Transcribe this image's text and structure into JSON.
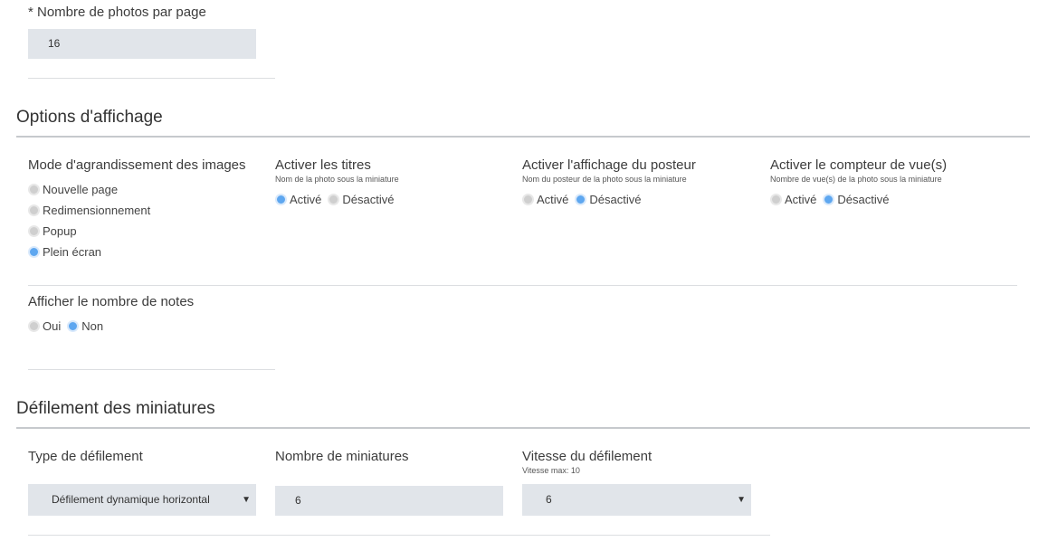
{
  "photos_per_page": {
    "label": "* Nombre de photos par page",
    "value": "16"
  },
  "display_options": {
    "title": "Options d'affichage",
    "enlarge_mode": {
      "label": "Mode d'agrandissement des images",
      "options": [
        "Nouvelle page",
        "Redimensionnement",
        "Popup",
        "Plein écran"
      ],
      "selected": "Plein écran"
    },
    "titles": {
      "label": "Activer les titres",
      "hint": "Nom de la photo sous la miniature",
      "on_label": "Activé",
      "off_label": "Désactivé",
      "selected": "Activé"
    },
    "poster": {
      "label": "Activer l'affichage du posteur",
      "hint": "Nom du posteur de la photo sous la miniature",
      "on_label": "Activé",
      "off_label": "Désactivé",
      "selected": "Désactivé"
    },
    "view_counter": {
      "label": "Activer le compteur de vue(s)",
      "hint": "Nombre de vue(s) de la photo sous la miniature",
      "on_label": "Activé",
      "off_label": "Désactivé",
      "selected": "Désactivé"
    },
    "notes_count": {
      "label": "Afficher le nombre de notes",
      "yes_label": "Oui",
      "no_label": "Non",
      "selected": "Non"
    }
  },
  "thumb_scroll": {
    "title": "Défilement des miniatures",
    "scroll_type": {
      "label": "Type de défilement",
      "value": "Défilement dynamique horizontal"
    },
    "thumb_count": {
      "label": "Nombre de miniatures",
      "value": "6"
    },
    "scroll_speed": {
      "label": "Vitesse du défilement",
      "hint": "Vitesse max: 10",
      "value": "6"
    }
  },
  "colors": {
    "radio_selected": "#5ea7f0",
    "radio_unselected": "#cfcfcf",
    "field_bg": "#e1e5ea"
  }
}
